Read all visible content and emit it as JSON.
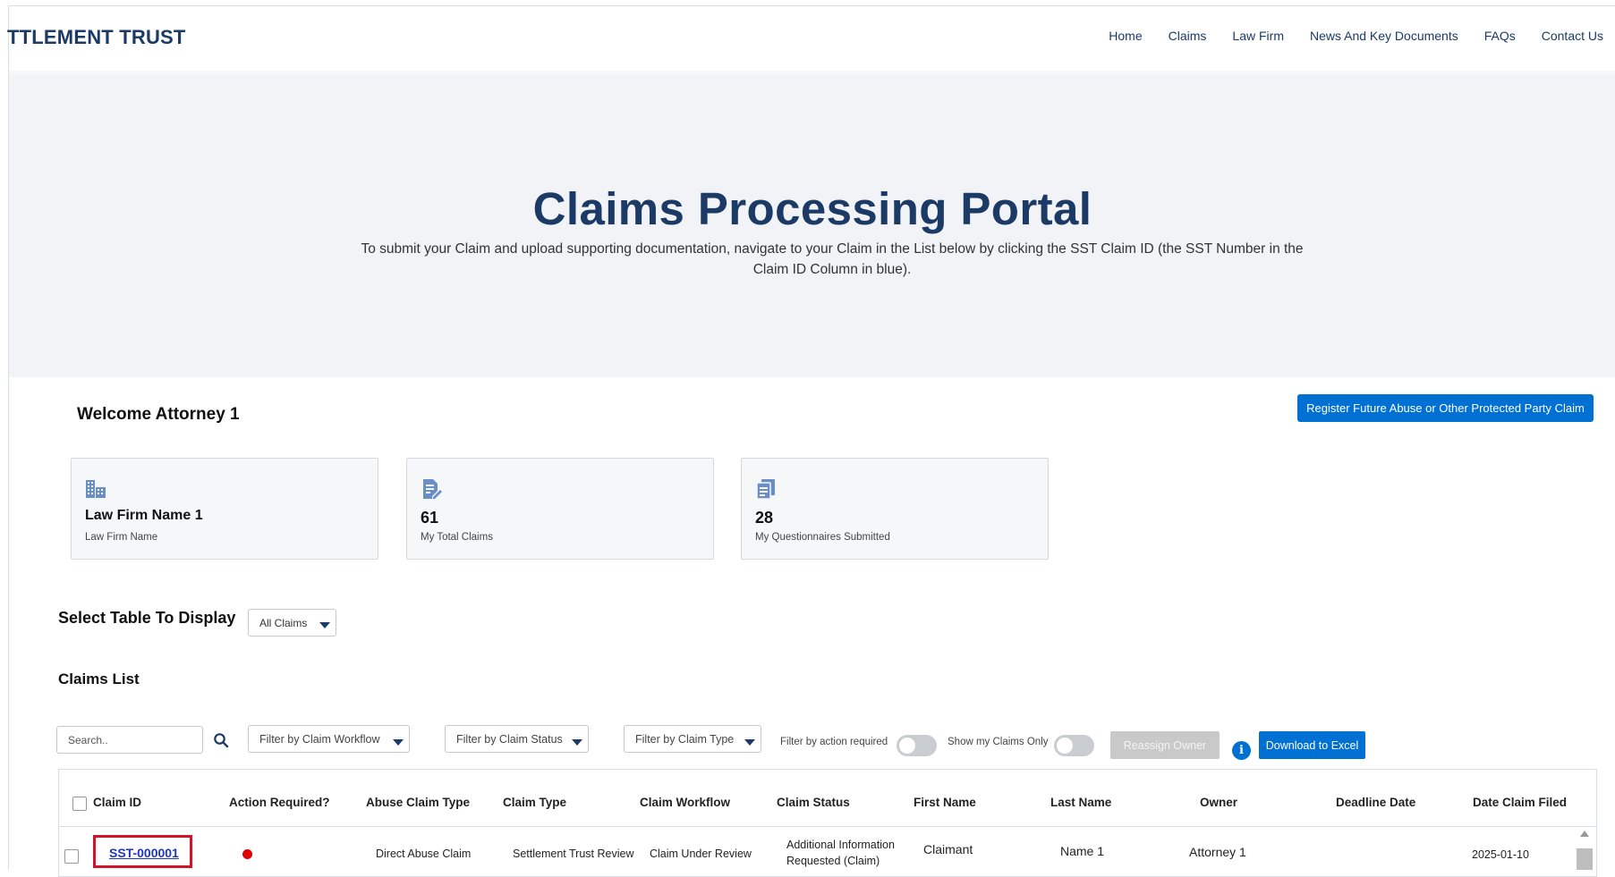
{
  "header": {
    "brand": "TTLEMENT TRUST",
    "nav": [
      "Home",
      "Claims",
      "Law Firm",
      "News And Key Documents",
      "FAQs",
      "Contact Us"
    ]
  },
  "hero": {
    "title": "Claims Processing Portal",
    "description": "To submit your Claim and upload supporting documentation, navigate to your Claim in the List below by clicking the SST Claim ID (the SST Number in the Claim ID Column in blue)."
  },
  "welcome": "Welcome Attorney 1",
  "register_button": "Register Future Abuse or Other Protected Party Claim",
  "cards": [
    {
      "value": "Law Firm Name 1",
      "label": "Law Firm Name",
      "icon": "building-icon"
    },
    {
      "value": "61",
      "label": "My Total Claims",
      "icon": "claims-edit-icon"
    },
    {
      "value": "28",
      "label": "My Questionnaires Submitted",
      "icon": "questionnaire-icon"
    }
  ],
  "select_table": {
    "title": "Select Table To Display",
    "value": "All Claims"
  },
  "claims_list": {
    "title": "Claims List",
    "search_placeholder": "Search..",
    "filters": {
      "workflow": "Filter by Claim Workflow",
      "status": "Filter by Claim Status",
      "type": "Filter by Claim Type",
      "action_required": "Filter by action required",
      "my_claims": "Show my Claims Only"
    },
    "reassign_label": "Reassign Owner",
    "download_label": "Download to Excel",
    "columns": [
      "Claim ID",
      "Action Required?",
      "Abuse Claim Type",
      "Claim Type",
      "Claim Workflow",
      "Claim Status",
      "First Name",
      "Last Name",
      "Owner",
      "Deadline Date",
      "Date Claim Filed"
    ],
    "rows": [
      {
        "claim_id": "SST-000001",
        "action_required": true,
        "abuse_claim_type": "Direct Abuse Claim",
        "claim_type": "Settlement Trust Review",
        "claim_workflow": "Claim Under Review",
        "claim_status_1": "Additional Information",
        "claim_status_2": "Requested (Claim)",
        "first_name": "Claimant",
        "last_name": "Name 1",
        "owner": "Attorney 1",
        "deadline_date": "",
        "date_filed": "2025-01-10"
      }
    ]
  },
  "colors": {
    "brand": "#1b3a66",
    "primary_button": "#0070d2",
    "link": "#1f36c7",
    "alert_dot": "#e00000",
    "highlight_box": "#d0152a"
  }
}
